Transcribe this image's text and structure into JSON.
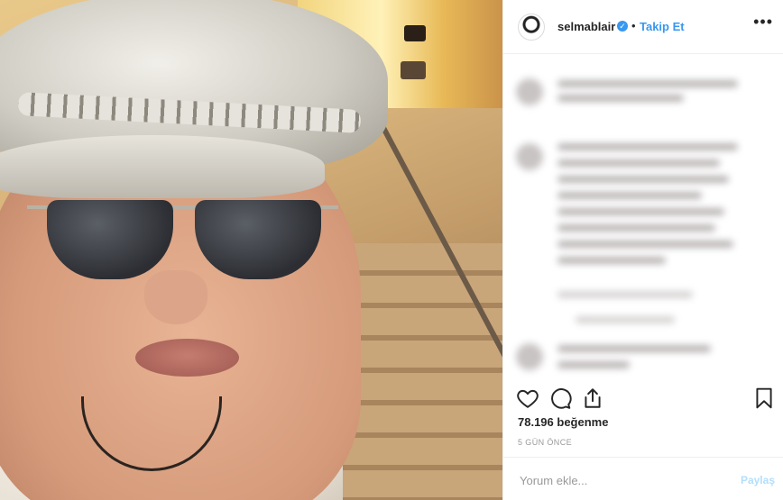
{
  "post": {
    "username": "selmablair",
    "separator": "•",
    "follow_label": "Takip Et",
    "more_label": "•••",
    "verified_glyph": "✓",
    "likes_text": "78.196 beğenme",
    "time_text": "5 GÜN ÖNCE",
    "comment": {
      "placeholder": "Yorum ekle...",
      "post_label": "Paylaş"
    }
  },
  "icons": {
    "like": "heart-icon",
    "comment": "comment-icon",
    "share": "share-icon",
    "save": "bookmark-icon"
  },
  "colors": {
    "accent": "#3897f0",
    "post_button_disabled": "#b2dffc",
    "text": "#262626",
    "muted": "#999999"
  }
}
